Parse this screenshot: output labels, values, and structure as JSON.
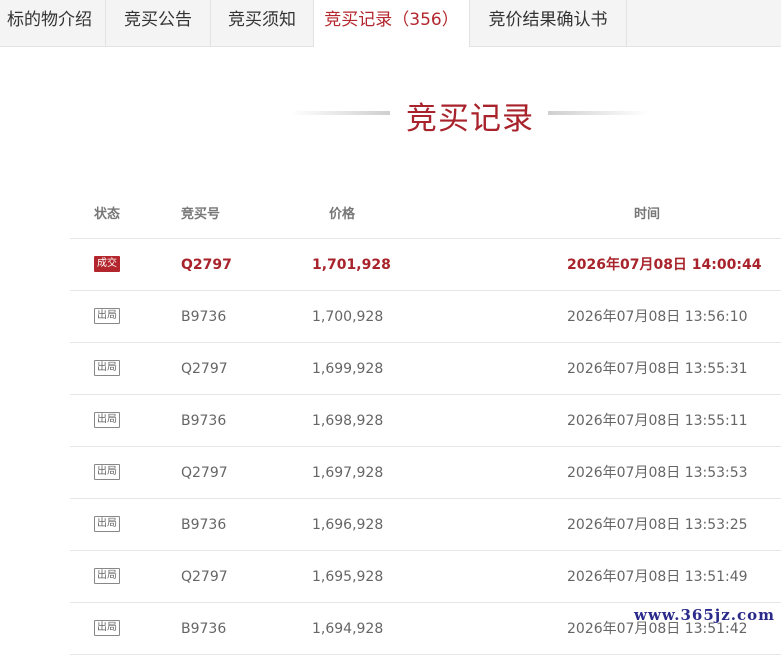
{
  "tabs": [
    {
      "label": "标的物介绍",
      "active": false
    },
    {
      "label": "竞买公告",
      "active": false
    },
    {
      "label": "竞买须知",
      "active": false
    },
    {
      "label": "竞买记录",
      "count": "（356）",
      "active": true
    },
    {
      "label": "竞价结果确认书",
      "active": false
    }
  ],
  "section": {
    "title": "竞买记录"
  },
  "table": {
    "headers": {
      "status": "状态",
      "bid_no": "竞买号",
      "price": "价格",
      "time": "时间"
    },
    "rows": [
      {
        "status": "成交",
        "bid_no": "Q2797",
        "price": "1,701,928",
        "time": "2026年07月08日 14:00:44"
      },
      {
        "status": "出局",
        "bid_no": "B9736",
        "price": "1,700,928",
        "time": "2026年07月08日 13:56:10"
      },
      {
        "status": "出局",
        "bid_no": "Q2797",
        "price": "1,699,928",
        "time": "2026年07月08日 13:55:31"
      },
      {
        "status": "出局",
        "bid_no": "B9736",
        "price": "1,698,928",
        "time": "2026年07月08日 13:55:11"
      },
      {
        "status": "出局",
        "bid_no": "Q2797",
        "price": "1,697,928",
        "time": "2026年07月08日 13:53:53"
      },
      {
        "status": "出局",
        "bid_no": "B9736",
        "price": "1,696,928",
        "time": "2026年07月08日 13:53:25"
      },
      {
        "status": "出局",
        "bid_no": "Q2797",
        "price": "1,695,928",
        "time": "2026年07月08日 13:51:49"
      },
      {
        "status": "出局",
        "bid_no": "B9736",
        "price": "1,694,928",
        "time": "2026年07月08日 13:51:42"
      }
    ]
  },
  "watermark": "www.365jz.com",
  "colors": {
    "accent": "#b3262d",
    "text": "#666666",
    "tab_bg": "#f4f4f4"
  }
}
